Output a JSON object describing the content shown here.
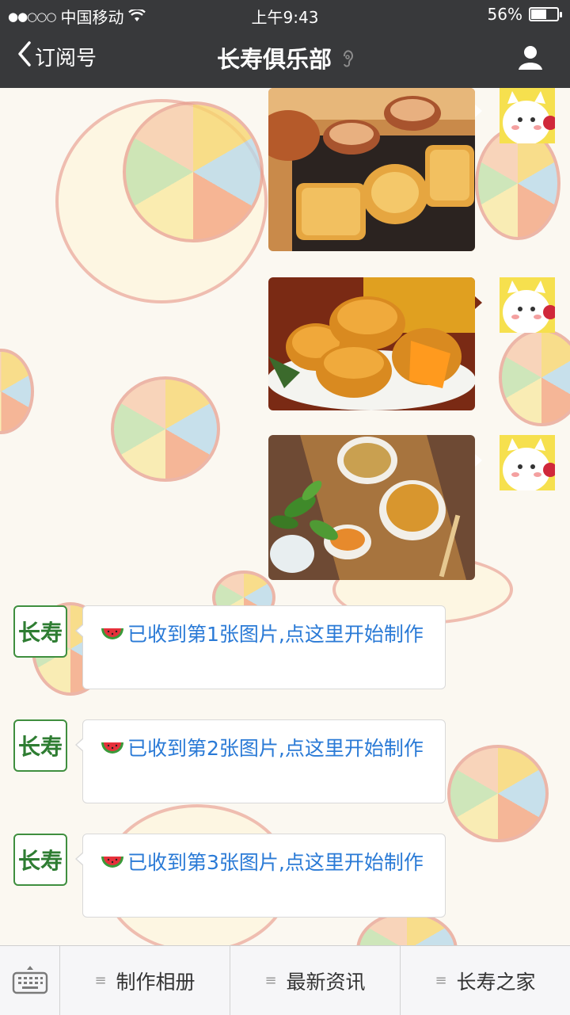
{
  "status_bar": {
    "carrier": "中国移动",
    "time": "上午9:43",
    "battery": "56%"
  },
  "nav": {
    "back_label": "订阅号",
    "title": "长寿俱乐部"
  },
  "messages_out": [
    {
      "image": "mooncakes-tea-tray"
    },
    {
      "image": "mooncakes-orange-plate"
    },
    {
      "image": "mooncakes-bamboo-mat"
    }
  ],
  "messages_in": [
    {
      "avatar_text": "长寿",
      "text": "已收到第1张图片,点这里开始制作"
    },
    {
      "avatar_text": "长寿",
      "text": "已收到第2张图片,点这里开始制作"
    },
    {
      "avatar_text": "长寿",
      "text": "已收到第3张图片,点这里开始制作"
    }
  ],
  "bottom_menu": {
    "items": [
      {
        "label": "制作相册"
      },
      {
        "label": "最新资讯"
      },
      {
        "label": "长寿之家"
      }
    ]
  },
  "colors": {
    "bar": "#38393b",
    "link": "#2a7ad6",
    "brand_green": "#3f8f3f"
  }
}
